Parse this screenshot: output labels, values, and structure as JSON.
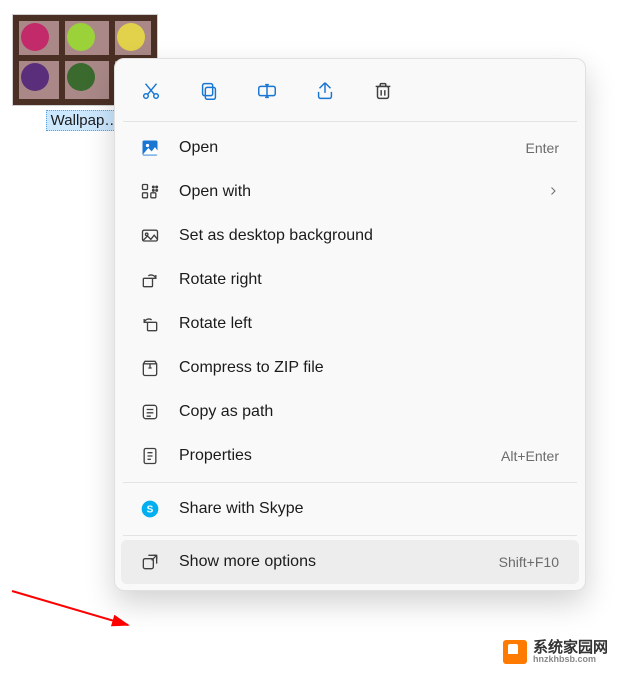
{
  "colors": {
    "icon_accent": "#1976d2",
    "menu_bg": "#f9f9f9",
    "highlight_bg": "#ededed",
    "trash_stroke": "#404040"
  },
  "desktop_icon": {
    "caption": "Wallpap…"
  },
  "toolbar": [
    {
      "name": "cut-icon"
    },
    {
      "name": "copy-icon"
    },
    {
      "name": "rename-icon"
    },
    {
      "name": "share-icon"
    },
    {
      "name": "delete-icon"
    }
  ],
  "menu": {
    "items": [
      {
        "icon": "open-image-icon",
        "label": "Open",
        "accel": "Enter",
        "submenu": false
      },
      {
        "icon": "open-with-icon",
        "label": "Open with",
        "accel": "",
        "submenu": true
      },
      {
        "icon": "set-background-icon",
        "label": "Set as desktop background",
        "accel": "",
        "submenu": false
      },
      {
        "icon": "rotate-right-icon",
        "label": "Rotate right",
        "accel": "",
        "submenu": false
      },
      {
        "icon": "rotate-left-icon",
        "label": "Rotate left",
        "accel": "",
        "submenu": false
      },
      {
        "icon": "compress-zip-icon",
        "label": "Compress to ZIP file",
        "accel": "",
        "submenu": false
      },
      {
        "icon": "copy-path-icon",
        "label": "Copy as path",
        "accel": "",
        "submenu": false
      },
      {
        "icon": "properties-icon",
        "label": "Properties",
        "accel": "Alt+Enter",
        "submenu": false
      }
    ],
    "items2": [
      {
        "icon": "skype-icon",
        "label": "Share with Skype",
        "accel": "",
        "submenu": false
      }
    ],
    "items3": [
      {
        "icon": "show-more-icon",
        "label": "Show more options",
        "accel": "Shift+F10",
        "submenu": false,
        "highlight": true
      }
    ]
  },
  "watermark": {
    "main": "系统家园网",
    "sub": "hnzkhbsb.com"
  }
}
